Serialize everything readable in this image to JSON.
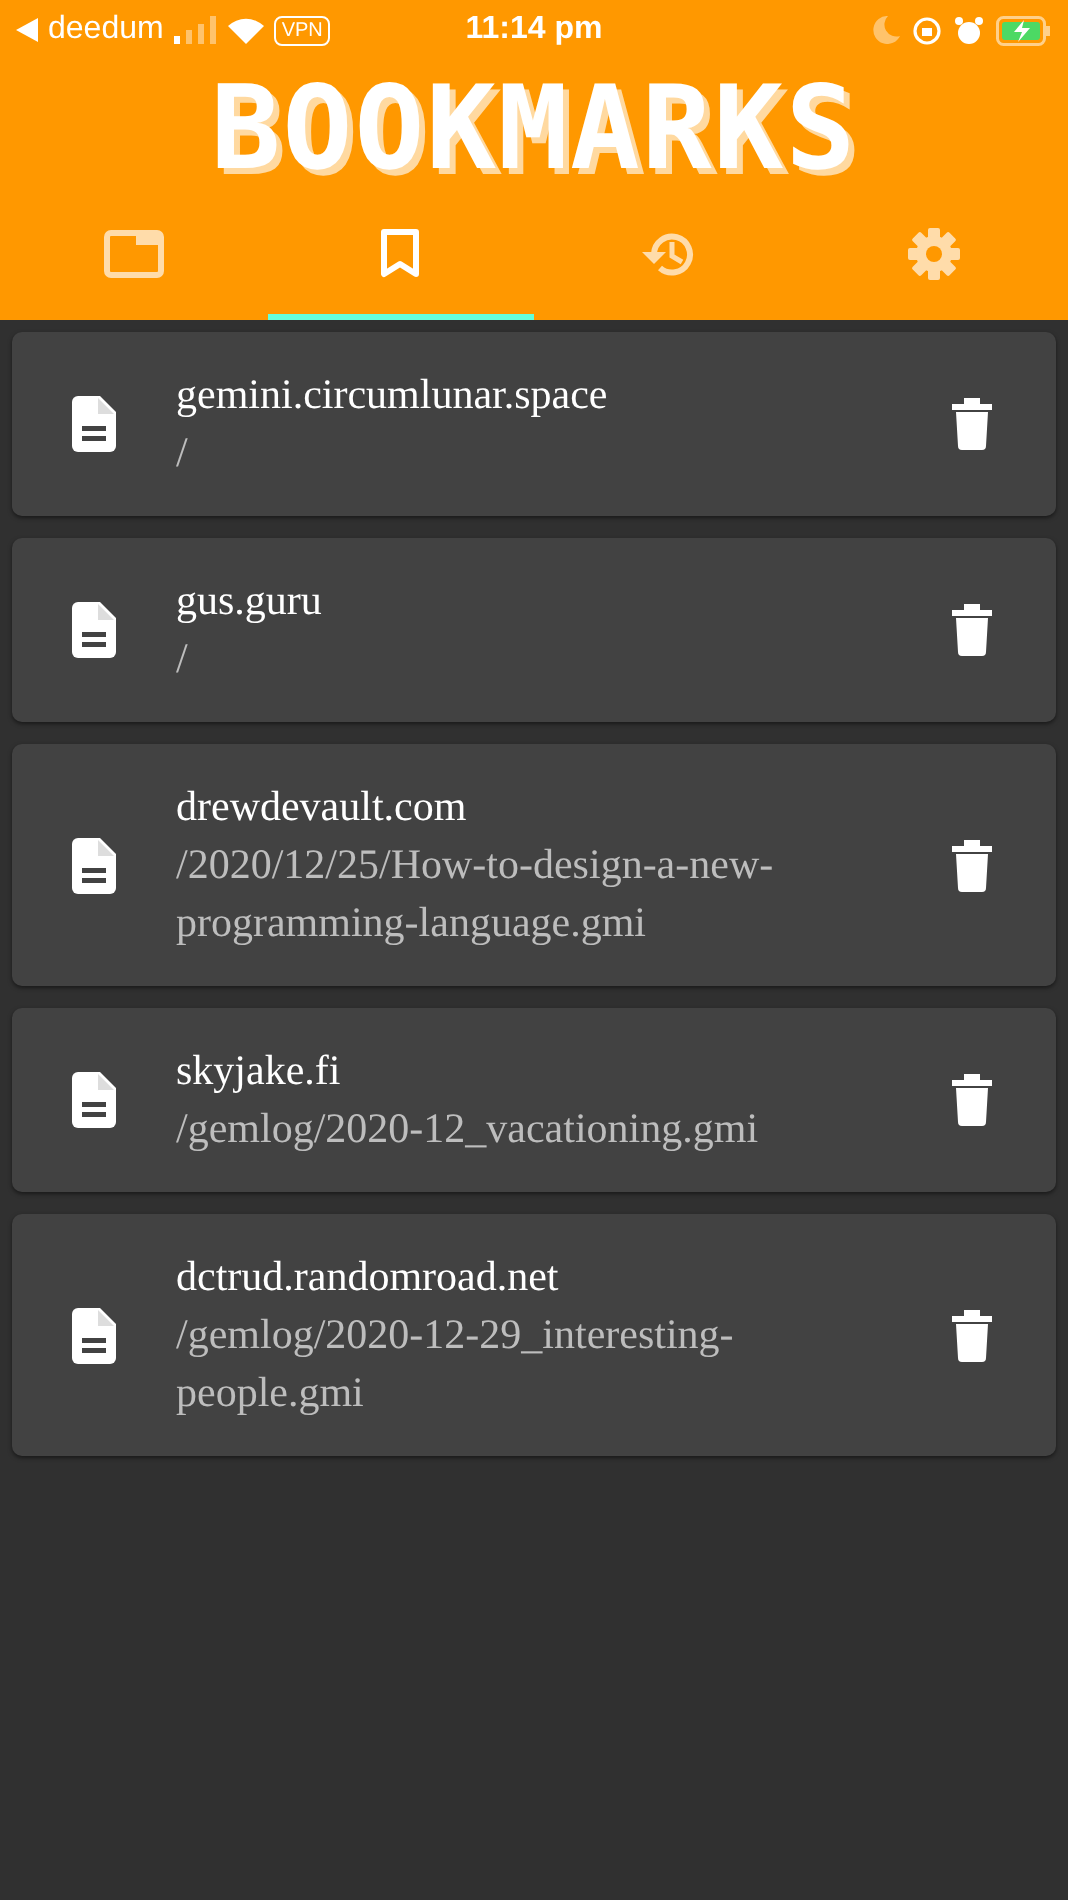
{
  "status_bar": {
    "back_app": "deedum",
    "vpn": "VPN",
    "time": "11:14 pm"
  },
  "header": {
    "title": "BOOKMARKS"
  },
  "tabs": [
    {
      "kind": "tabs",
      "selected": false
    },
    {
      "kind": "bookmarks",
      "selected": true
    },
    {
      "kind": "history",
      "selected": false
    },
    {
      "kind": "settings",
      "selected": false
    }
  ],
  "bookmarks": [
    {
      "host": "gemini.circumlunar.space",
      "path": "/"
    },
    {
      "host": "gus.guru",
      "path": "/"
    },
    {
      "host": "drewdevault.com",
      "path": "/2020/12/25/How-to-design-a-new-programming-language.gmi"
    },
    {
      "host": "skyjake.fi",
      "path": "/gemlog/2020-12_vacationing.gmi"
    },
    {
      "host": "dctrud.randomroad.net",
      "path": "/gemlog/2020-12-29_interesting-people.gmi"
    }
  ]
}
